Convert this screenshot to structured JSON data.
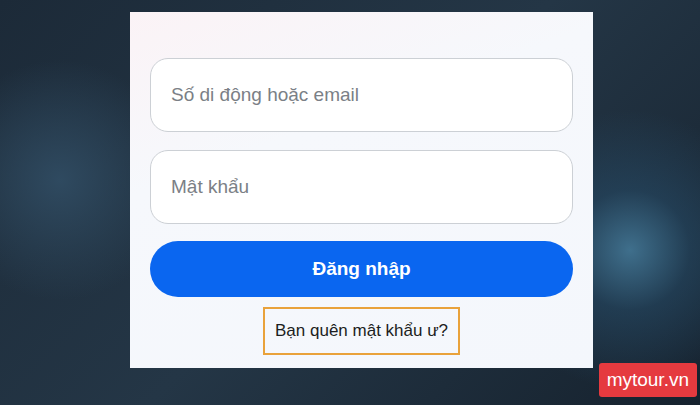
{
  "fields": [
    {
      "kind": "text",
      "placeholder": "Số di động hoặc email"
    },
    {
      "kind": "password",
      "placeholder": "Mật khẩu"
    }
  ],
  "login_button": {
    "label": "Đăng nhập"
  },
  "forgot_link": {
    "label": "Bạn quên mật khẩu ư?",
    "highlighted": true
  },
  "watermark": {
    "text": "mytour.vn"
  }
}
